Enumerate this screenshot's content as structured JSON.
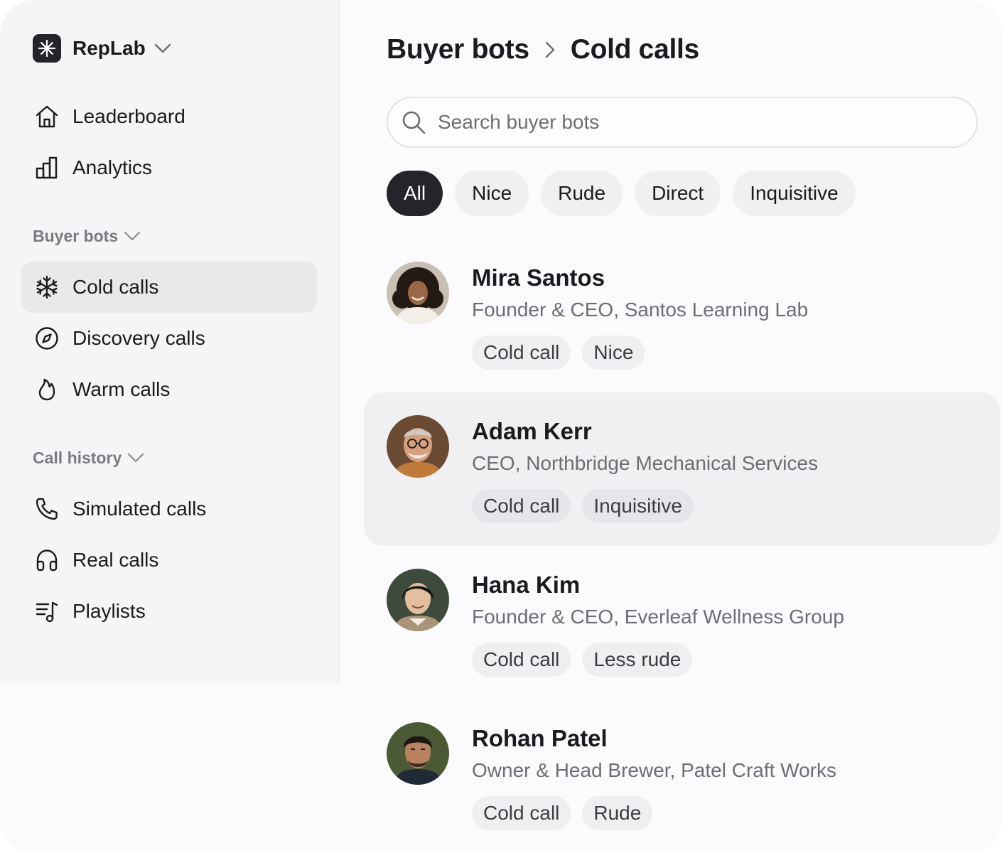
{
  "brand": {
    "name": "RepLab",
    "logo_icon": "sparkle-icon"
  },
  "nav": {
    "primary": [
      {
        "label": "Leaderboard",
        "icon": "home-icon"
      },
      {
        "label": "Analytics",
        "icon": "bar-chart-icon"
      }
    ],
    "sections": [
      {
        "title": "Buyer bots",
        "items": [
          {
            "label": "Cold calls",
            "icon": "snowflake-icon",
            "active": true
          },
          {
            "label": "Discovery calls",
            "icon": "compass-icon"
          },
          {
            "label": "Warm calls",
            "icon": "flame-icon"
          }
        ]
      },
      {
        "title": "Call history",
        "items": [
          {
            "label": "Simulated calls",
            "icon": "phone-icon"
          },
          {
            "label": "Real calls",
            "icon": "headphones-icon"
          },
          {
            "label": "Playlists",
            "icon": "playlist-icon"
          }
        ]
      }
    ]
  },
  "breadcrumb": {
    "parent": "Buyer bots",
    "current": "Cold calls"
  },
  "search": {
    "placeholder": "Search buyer bots",
    "value": ""
  },
  "filters": [
    "All",
    "Nice",
    "Rude",
    "Direct",
    "Inquisitive"
  ],
  "active_filter": "All",
  "bots": [
    {
      "name": "Mira Santos",
      "role": "Founder & CEO, Santos Learning Lab",
      "tags": [
        "Cold call",
        "Nice"
      ]
    },
    {
      "name": "Adam Kerr",
      "role": "CEO, Northbridge Mechanical Services",
      "tags": [
        "Cold call",
        "Inquisitive"
      ],
      "highlighted": true
    },
    {
      "name": "Hana Kim",
      "role": "Founder & CEO, Everleaf Wellness Group",
      "tags": [
        "Cold call",
        "Less rude"
      ]
    },
    {
      "name": "Rohan Patel",
      "role": "Owner & Head Brewer, Patel Craft Works",
      "tags": [
        "Cold call",
        "Rude"
      ]
    }
  ],
  "colors": {
    "accent_dark": "#24252a",
    "highlight": "#f0eff2",
    "muted_text": "#6e6d73"
  }
}
